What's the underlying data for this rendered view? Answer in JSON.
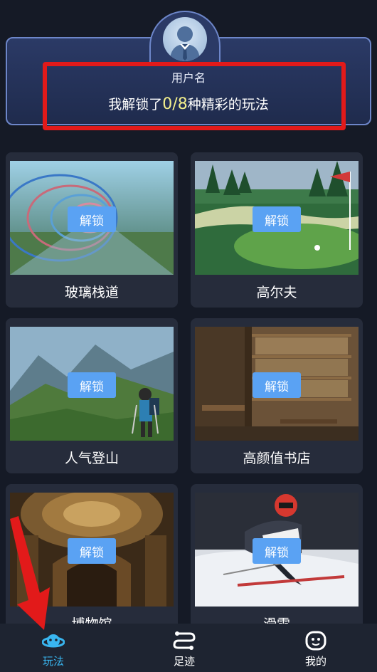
{
  "header": {
    "username": "用户名",
    "unlock_prefix": "我解锁了",
    "unlock_count": "0/8",
    "unlock_suffix": "种精彩的玩法"
  },
  "cards": [
    {
      "title": "玻璃栈道",
      "button": "解锁",
      "scene": "glass-walkway"
    },
    {
      "title": "高尔夫",
      "button": "解锁",
      "scene": "golf"
    },
    {
      "title": "人气登山",
      "button": "解锁",
      "scene": "mountain-hiking"
    },
    {
      "title": "高颜值书店",
      "button": "解锁",
      "scene": "bookstore"
    },
    {
      "title": "博物馆",
      "button": "解锁",
      "scene": "museum"
    },
    {
      "title": "滑雪",
      "button": "解锁",
      "scene": "skiing"
    }
  ],
  "bottom_nav": [
    {
      "label": "玩法",
      "icon": "planet-icon",
      "active": true
    },
    {
      "label": "足迹",
      "icon": "route-icon",
      "active": false
    },
    {
      "label": "我的",
      "icon": "face-icon",
      "active": false
    }
  ],
  "colors": {
    "background": "#151a26",
    "card": "#262c3b",
    "accent": "#39b6f0",
    "button": "#5aa2f3",
    "highlight": "#f3ef8c",
    "annotation": "#e21a1a"
  }
}
